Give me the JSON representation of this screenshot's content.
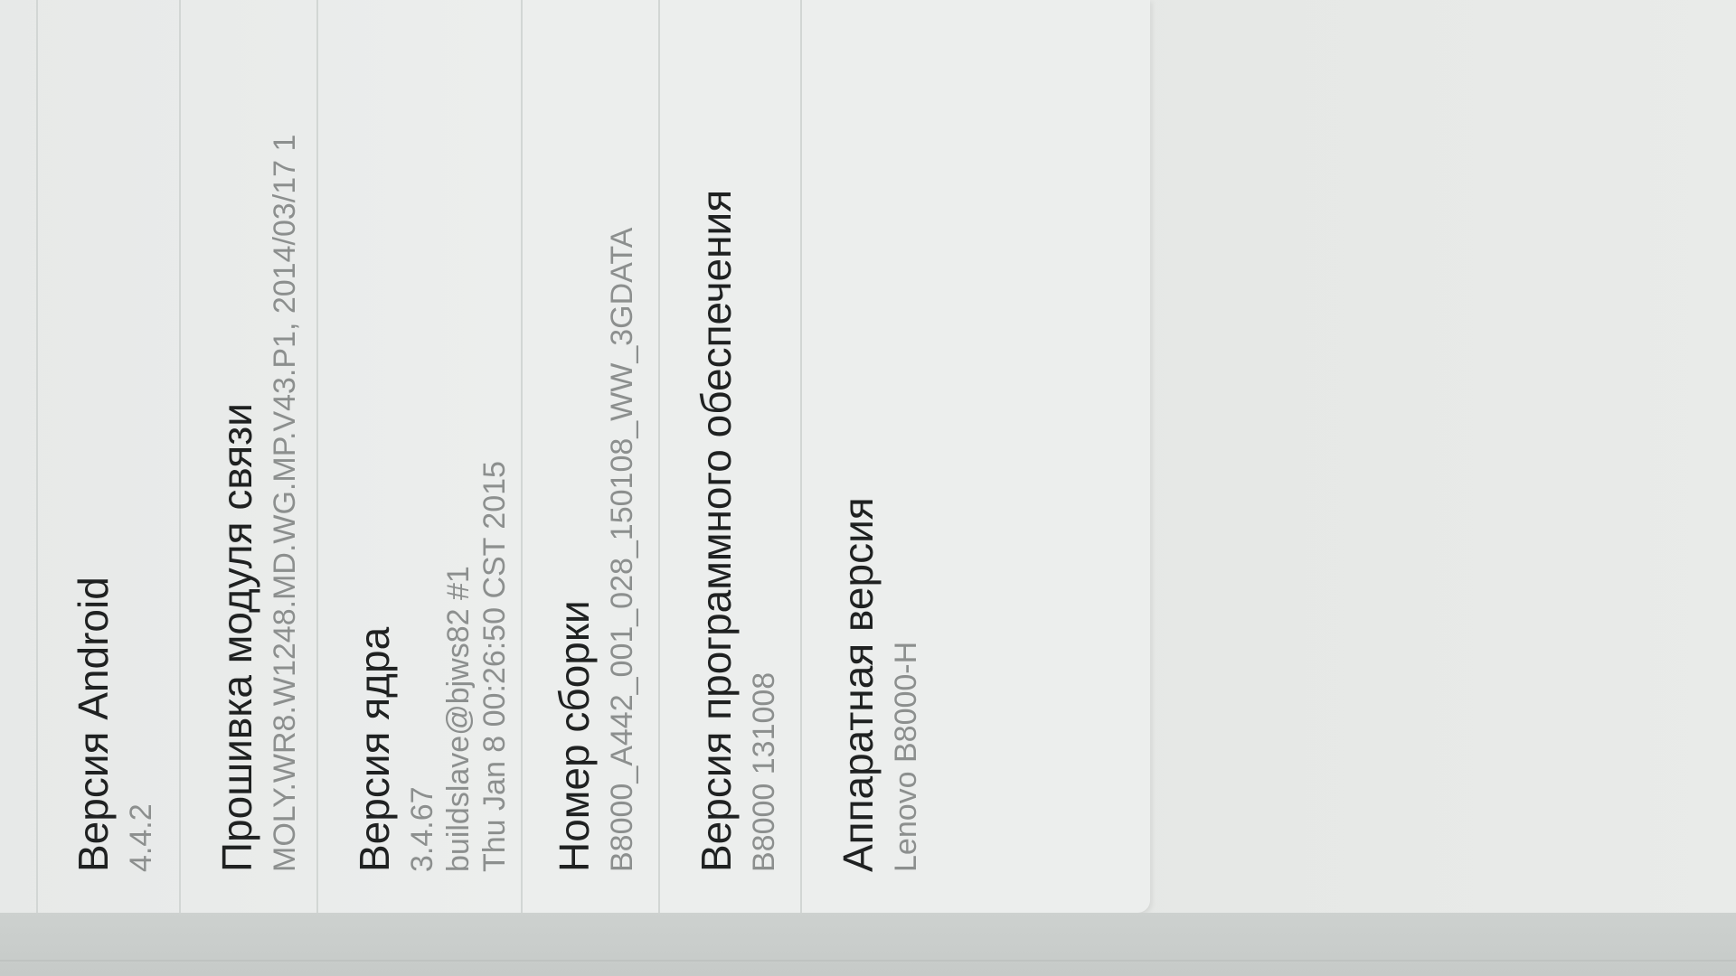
{
  "settings": {
    "android_version": {
      "title": "Версия Android",
      "value": "4.4.2"
    },
    "baseband_version": {
      "title": "Прошивка модуля связи",
      "value": "MOLY.WR8.W1248.MD.WG.MP.V43.P1, 2014/03/17 1"
    },
    "kernel_version": {
      "title": "Версия ядра",
      "line1": "3.4.67",
      "line2": "buildslave@bjws82 #1",
      "line3": "Thu Jan 8 00:26:50 CST 2015"
    },
    "build_number": {
      "title": "Номер сборки",
      "value": "B8000_A442_001_028_150108_WW_3GDATA"
    },
    "software_version": {
      "title": "Версия программного обеспечения",
      "value": "B8000 131008"
    },
    "hardware_version": {
      "title": "Аппаратная версия",
      "value": "Lenovo B8000-H"
    }
  }
}
